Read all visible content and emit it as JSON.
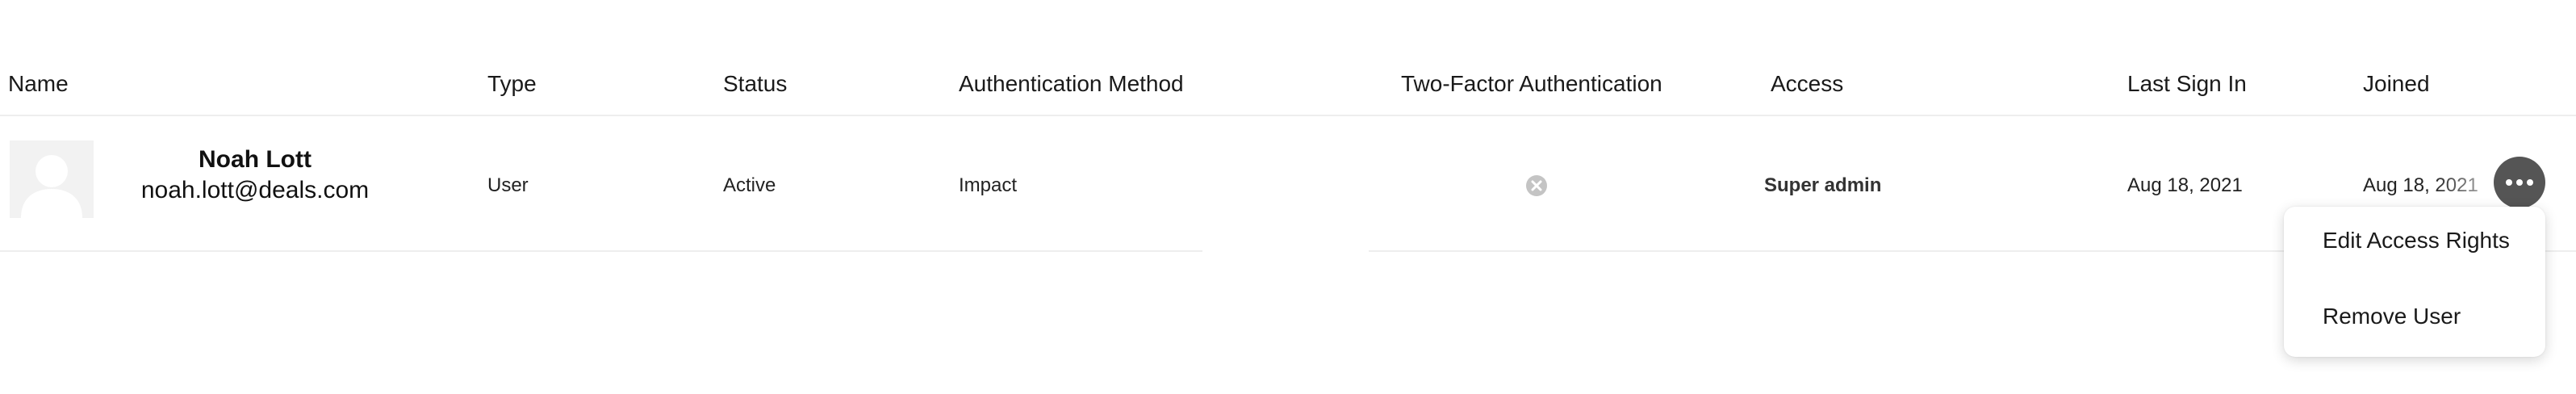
{
  "table": {
    "headers": {
      "name": "Name",
      "type": "Type",
      "status": "Status",
      "auth_method": "Authentication Method",
      "two_factor": "Two-Factor Authentication",
      "access": "Access",
      "last_sign_in": "Last Sign In",
      "joined": "Joined"
    },
    "rows": [
      {
        "name": "Noah Lott",
        "email": "noah.lott@deals.com",
        "type": "User",
        "status": "Active",
        "auth_method": "Impact",
        "two_factor_icon": "x-circle-icon",
        "access": "Super admin",
        "last_sign_in": "Aug 18, 2021",
        "joined": "Aug 18, 2021"
      }
    ]
  },
  "context_menu": {
    "items": [
      "Edit Access Rights",
      "Remove User"
    ]
  },
  "colors": {
    "more_button_bg": "#555555",
    "divider": "#eeeeee",
    "two_factor_icon": "#c4c4c4",
    "avatar_bg": "#f2f2f2"
  }
}
